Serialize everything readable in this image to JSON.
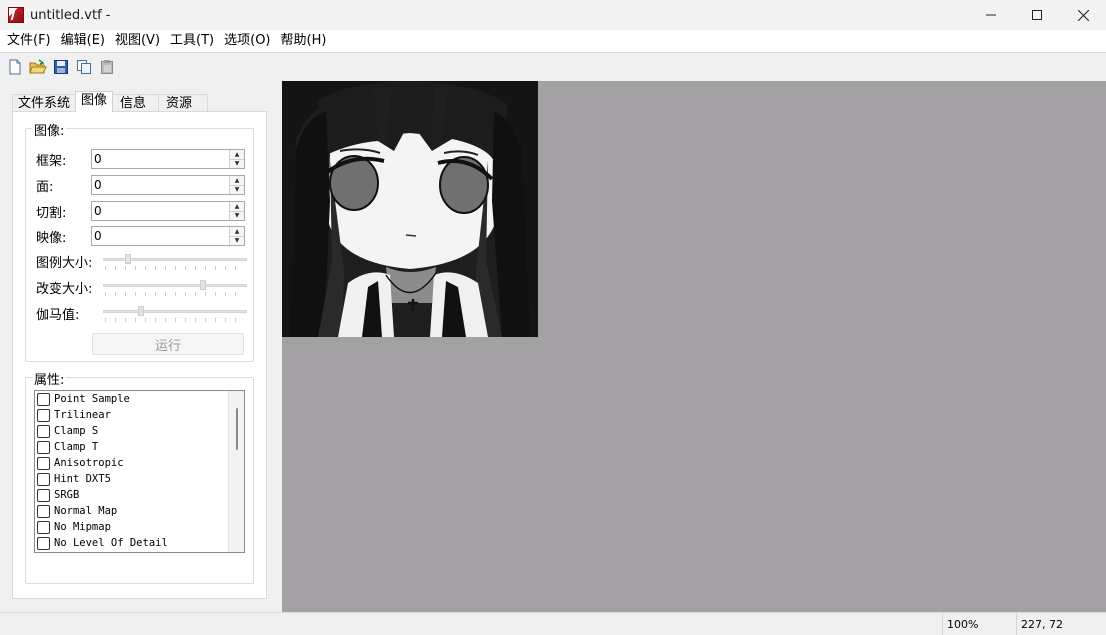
{
  "window": {
    "title": "untitled.vtf -",
    "controls": {
      "minimize": "minimize-icon",
      "maximize": "maximize-icon",
      "close": "close-icon"
    }
  },
  "menu": [
    "文件(F)",
    "编辑(E)",
    "视图(V)",
    "工具(T)",
    "选项(O)",
    "帮助(H)"
  ],
  "toolbar": {
    "icons": [
      "new-file-icon",
      "open-folder-icon",
      "save-icon",
      "copy-icon",
      "paste-icon"
    ]
  },
  "tabs": [
    "文件系统",
    "图像",
    "信息",
    "资源"
  ],
  "active_tab": "图像",
  "image_group": {
    "legend": "图像:",
    "frame": {
      "label": "框架:",
      "value": "0"
    },
    "face": {
      "label": "面:",
      "value": "0"
    },
    "slice": {
      "label": "切割:",
      "value": "0"
    },
    "mipmap": {
      "label": "映像:",
      "value": "0"
    },
    "sliders": [
      {
        "label": "图例大小:",
        "level": 0.16
      },
      {
        "label": "改变大小:",
        "level": 0.7
      },
      {
        "label": "伽马值:",
        "level": 0.25
      }
    ],
    "run_label": "运行"
  },
  "properties_group": {
    "legend": "属性:",
    "items": [
      {
        "label": "Point Sample",
        "checked": false
      },
      {
        "label": "Trilinear",
        "checked": false
      },
      {
        "label": "Clamp S",
        "checked": false
      },
      {
        "label": "Clamp T",
        "checked": false
      },
      {
        "label": "Anisotropic",
        "checked": false
      },
      {
        "label": "Hint DXT5",
        "checked": false
      },
      {
        "label": "SRGB",
        "checked": false
      },
      {
        "label": "Normal Map",
        "checked": false
      },
      {
        "label": "No Mipmap",
        "checked": false
      },
      {
        "label": "No Level Of Detail",
        "checked": false
      }
    ]
  },
  "status": {
    "zoom": "100%",
    "coords": "227,  72"
  },
  "colors": {
    "canvas_bg": "#a3a1a4",
    "accent_icon": "#c0202a"
  }
}
